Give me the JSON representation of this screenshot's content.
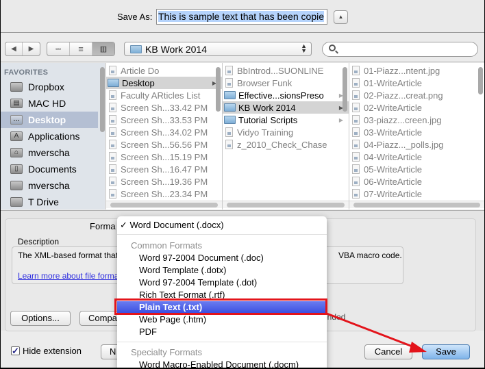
{
  "save_as": {
    "label": "Save As:",
    "value": "This is sample text that has been copie",
    "collapse_icon": "triangle-up-icon"
  },
  "toolbar": {
    "back_icon": "back-arrow-icon",
    "forward_icon": "forward-arrow-icon",
    "view_icons": [
      "icon-view-icon",
      "list-view-icon",
      "column-view-icon"
    ],
    "active_view": "column-view",
    "location": "KB Work 2014",
    "search_placeholder": ""
  },
  "sidebar": {
    "heading": "FAVORITES",
    "items": [
      {
        "label": "Dropbox",
        "icon": "folder-icon"
      },
      {
        "label": "MAC HD",
        "icon": "hard-drive-icon"
      },
      {
        "label": "Desktop",
        "icon": "desktop-icon",
        "selected": true
      },
      {
        "label": "Applications",
        "icon": "applications-icon"
      },
      {
        "label": "mverscha",
        "icon": "home-icon"
      },
      {
        "label": "Documents",
        "icon": "documents-icon"
      },
      {
        "label": "mverscha",
        "icon": "folder-icon"
      },
      {
        "label": "T Drive",
        "icon": "folder-icon"
      }
    ]
  },
  "columns": [
    {
      "items": [
        {
          "name": "Article Do",
          "kind": "file"
        },
        {
          "name": "Desktop",
          "kind": "folder",
          "selected": true
        },
        {
          "name": "Faculty ARticles List",
          "kind": "file"
        },
        {
          "name": "Screen Sh...33.42 PM",
          "kind": "file"
        },
        {
          "name": "Screen Sh...33.53 PM",
          "kind": "file"
        },
        {
          "name": "Screen Sh...34.02 PM",
          "kind": "file"
        },
        {
          "name": "Screen Sh...56.56 PM",
          "kind": "file"
        },
        {
          "name": "Screen Sh...15.19 PM",
          "kind": "file"
        },
        {
          "name": "Screen Sh...16.47 PM",
          "kind": "file"
        },
        {
          "name": "Screen Sh...19.36 PM",
          "kind": "file"
        },
        {
          "name": "Screen Sh...23.34 PM",
          "kind": "file"
        }
      ]
    },
    {
      "items": [
        {
          "name": "BbIntrod...SUONLINE",
          "kind": "file"
        },
        {
          "name": "Browser Funk",
          "kind": "file"
        },
        {
          "name": "Effective...sionsPreso",
          "kind": "folder"
        },
        {
          "name": "KB Work 2014",
          "kind": "folder",
          "selected": true
        },
        {
          "name": "Tutorial Scripts",
          "kind": "folder"
        },
        {
          "name": "Vidyo Training",
          "kind": "file"
        },
        {
          "name": "z_2010_Check_Chase",
          "kind": "file"
        }
      ]
    },
    {
      "items": [
        {
          "name": "01-Piazz...ntent.jpg",
          "kind": "file"
        },
        {
          "name": "01-WriteArticle",
          "kind": "file"
        },
        {
          "name": "02-Piazz...creat.png",
          "kind": "file"
        },
        {
          "name": "02-WriteArticle",
          "kind": "file"
        },
        {
          "name": "03-piazz...creen.jpg",
          "kind": "file"
        },
        {
          "name": "03-WriteArticle",
          "kind": "file"
        },
        {
          "name": "04-Piazz..._polls.jpg",
          "kind": "file"
        },
        {
          "name": "04-WriteArticle",
          "kind": "file"
        },
        {
          "name": "05-WriteArticle",
          "kind": "file"
        },
        {
          "name": "06-WriteArticle",
          "kind": "file"
        },
        {
          "name": "07-WriteArticle",
          "kind": "file"
        }
      ]
    }
  ],
  "format": {
    "label": "Forma",
    "description_label": "Description",
    "description_text": "The XML-based format that",
    "description_tail": "VBA macro code.",
    "learn_more": "Learn more about file forma",
    "extension_note": "ended"
  },
  "format_menu": {
    "selected": "Word Document (.docx)",
    "groups": [
      {
        "header": "Common Formats",
        "items": [
          "Word 97-2004 Document (.doc)",
          "Word Template (.dotx)",
          "Word 97-2004 Template (.dot)",
          "Rich Text Format (.rtf)",
          "Plain Text (.txt)",
          "Web Page (.htm)",
          "PDF"
        ]
      },
      {
        "header": "Specialty Formats",
        "items": [
          "Word Macro-Enabled Document (.docm)"
        ]
      }
    ],
    "highlighted": "Plain Text (.txt)"
  },
  "buttons": {
    "options": "Options...",
    "compatibility": "Compa",
    "new_folder": "N",
    "cancel": "Cancel",
    "save": "Save"
  },
  "hide_extension": {
    "label": "Hide extension",
    "checked": true
  },
  "annotation": {
    "box_color": "#e3141b",
    "arrow_color": "#e3141b"
  }
}
